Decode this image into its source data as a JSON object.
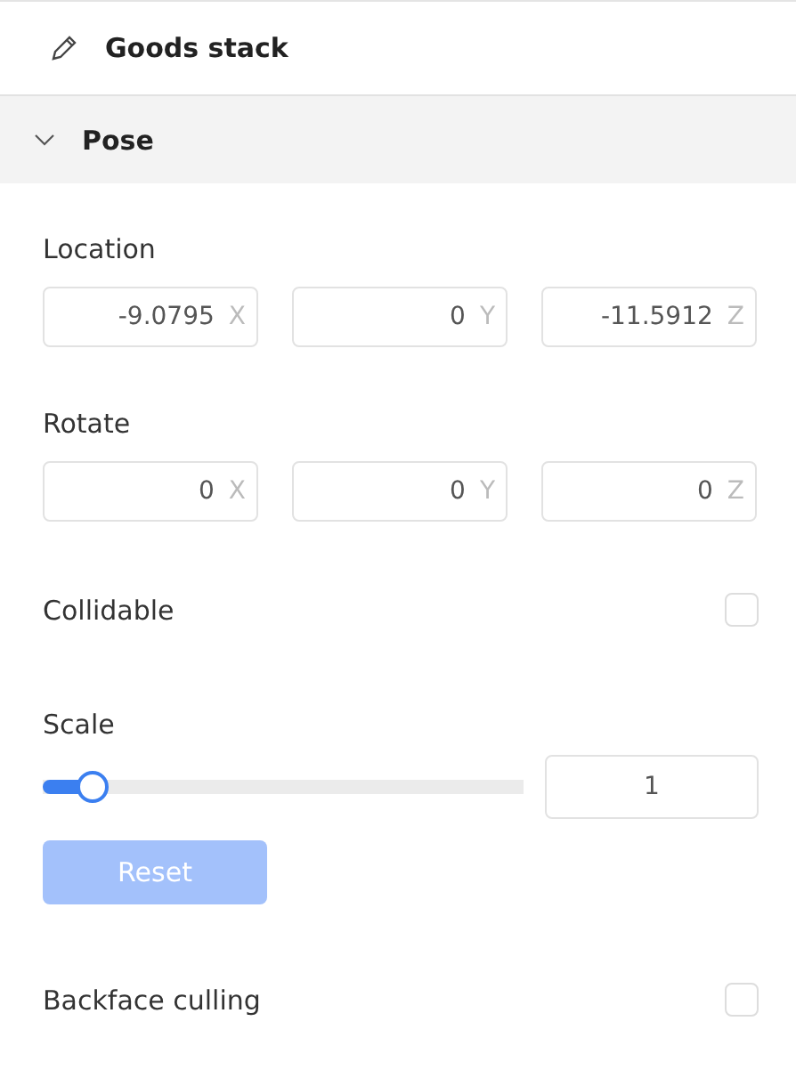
{
  "header": {
    "title": "Goods stack"
  },
  "section": {
    "title": "Pose",
    "expanded": true
  },
  "vectors": [
    {
      "label": "Location",
      "fields": [
        {
          "value": "-9.0795",
          "axis": "X"
        },
        {
          "value": "0",
          "axis": "Y"
        },
        {
          "value": "-11.5912",
          "axis": "Z"
        }
      ]
    },
    {
      "label": "Rotate",
      "fields": [
        {
          "value": "0",
          "axis": "X"
        },
        {
          "value": "0",
          "axis": "Y"
        },
        {
          "value": "0",
          "axis": "Z"
        }
      ]
    }
  ],
  "collidable": {
    "label": "Collidable",
    "checked": false
  },
  "scale": {
    "label": "Scale",
    "level": 0.1,
    "value": "1"
  },
  "reset": {
    "label": "Reset",
    "disabled": true
  },
  "backface": {
    "label": "Backface culling",
    "checked": false
  }
}
